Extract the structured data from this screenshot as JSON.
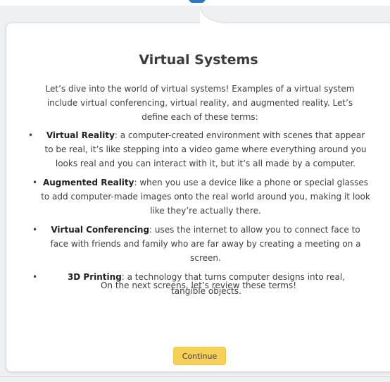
{
  "lesson": {
    "title": "Virtual Systems",
    "intro": "Let’s dive into the world of virtual systems! Examples of a virtual system include virtual conferencing, virtual reality, and augmented reality. Let’s define each of these terms:",
    "terms": [
      {
        "bullet": "•",
        "name": "Virtual Reality",
        "definition": ": a computer-created environment with scenes that appear to be real, it’s like stepping into a video game where everything around you looks real and you can interact with it, but it’s all made by a computer."
      },
      {
        "bullet": "•",
        "name": "Augmented Reality",
        "definition": ": when you use a device like a phone or special glasses to add computer-made images onto the real world around you, making it look like they’re actually there."
      },
      {
        "bullet": "•",
        "name": "Virtual Conferencing",
        "definition": ": uses the internet to allow you to connect face to face with friends and family who are far away by creating a meeting on a screen."
      },
      {
        "bullet": "•",
        "name": "3D Printing",
        "definition": ": a technology that turns computer designs into real, tangible objects."
      }
    ],
    "outro": "On the next screens, let’s review these terms!",
    "continue_label": "Continue"
  },
  "colors": {
    "button_bg": "#f6d155",
    "text": "#3c3c3c",
    "accent_peek": "#2b78c5",
    "page_bg": "#eef0f2"
  }
}
